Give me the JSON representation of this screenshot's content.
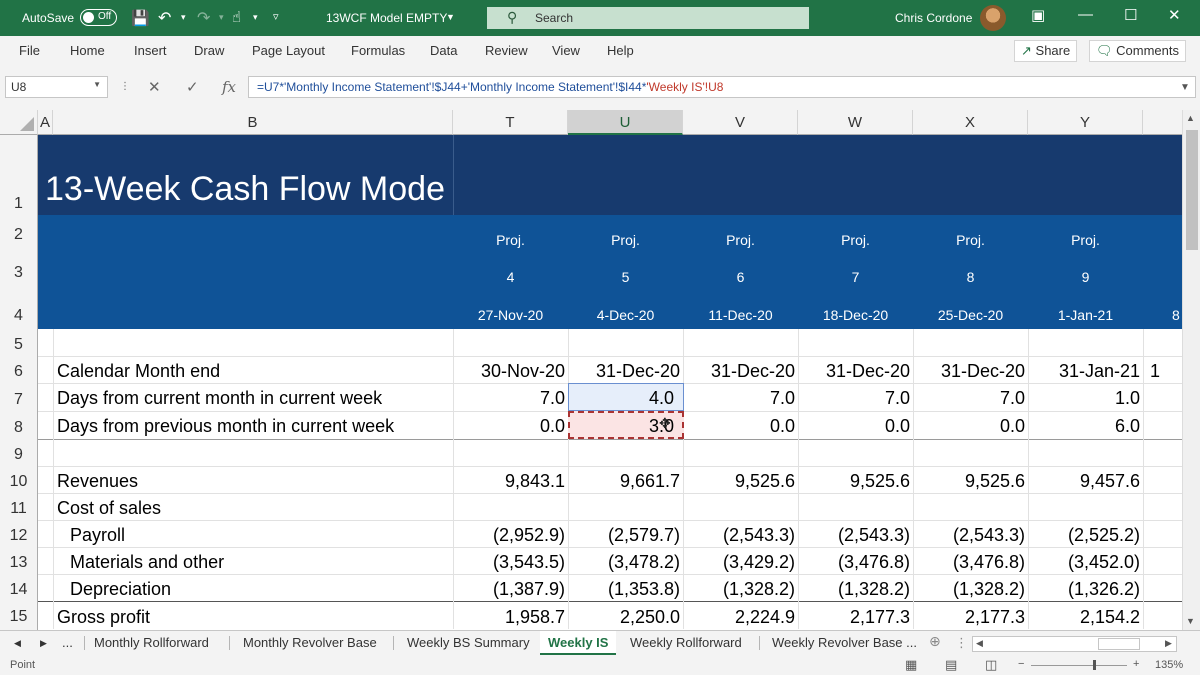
{
  "titlebar": {
    "autosave_label": "AutoSave",
    "autosave_state": "Off",
    "document_title": "13WCF Model EMPTY",
    "search_placeholder": "Search",
    "user_name": "Chris Cordone"
  },
  "ribbon": {
    "tabs": [
      "File",
      "Home",
      "Insert",
      "Draw",
      "Page Layout",
      "Formulas",
      "Data",
      "Review",
      "View",
      "Help"
    ],
    "share_label": "Share",
    "comments_label": "Comments"
  },
  "formula_bar": {
    "name_box": "U8",
    "fx": "fx",
    "formula_part1": "=U7*'Monthly Income Statement'!$J44+'Monthly Income Statement'!$I44*",
    "formula_part2": "'Weekly IS'!U8"
  },
  "grid": {
    "column_headers": [
      "A",
      "B",
      "T",
      "U",
      "V",
      "W",
      "X",
      "Y"
    ],
    "row_numbers": [
      "1",
      "2",
      "3",
      "4",
      "5",
      "6",
      "7",
      "8",
      "9",
      "10",
      "11",
      "12",
      "13",
      "14",
      "15"
    ],
    "title": "13-Week Cash Flow Mode",
    "proj_label": "Proj.",
    "week_numbers": [
      "4",
      "5",
      "6",
      "7",
      "8",
      "9"
    ],
    "week_dates": [
      "27-Nov-20",
      "4-Dec-20",
      "11-Dec-20",
      "18-Dec-20",
      "25-Dec-20",
      "1-Jan-21"
    ],
    "overflow_date_fragment": "8",
    "overflow_month_fragment": "1",
    "rows": [
      {
        "label": "Calendar Month end",
        "values": [
          "30-Nov-20",
          "31-Dec-20",
          "31-Dec-20",
          "31-Dec-20",
          "31-Dec-20",
          "31-Jan-21"
        ]
      },
      {
        "label": "Days from current month in current week",
        "values": [
          "7.0",
          "4.0",
          "7.0",
          "7.0",
          "7.0",
          "1.0"
        ]
      },
      {
        "label": "Days from previous month in current week",
        "values": [
          "0.0",
          "3.0",
          "0.0",
          "0.0",
          "0.0",
          "6.0"
        ]
      },
      {
        "label": "",
        "values": []
      },
      {
        "label": "Revenues",
        "values": [
          "9,843.1",
          "9,661.7",
          "9,525.6",
          "9,525.6",
          "9,525.6",
          "9,457.6"
        ]
      },
      {
        "label": "Cost of sales",
        "values": []
      },
      {
        "label": "Payroll",
        "values": [
          "(2,952.9)",
          "(2,579.7)",
          "(2,543.3)",
          "(2,543.3)",
          "(2,543.3)",
          "(2,525.2)"
        ]
      },
      {
        "label": "Materials and other",
        "values": [
          "(3,543.5)",
          "(3,478.2)",
          "(3,429.2)",
          "(3,476.8)",
          "(3,476.8)",
          "(3,452.0)"
        ]
      },
      {
        "label": "Depreciation",
        "values": [
          "(1,387.9)",
          "(1,353.8)",
          "(1,328.2)",
          "(1,328.2)",
          "(1,328.2)",
          "(1,326.2)"
        ]
      },
      {
        "label": "Gross profit",
        "values": [
          "1,958.7",
          "2,250.0",
          "2,224.9",
          "2,177.3",
          "2,177.3",
          "2,154.2"
        ]
      }
    ]
  },
  "sheet_tabs": {
    "ellipsis": "...",
    "tabs": [
      "Monthly Rollforward",
      "Monthly Revolver Base",
      "Weekly BS Summary",
      "Weekly IS",
      "Weekly Rollforward",
      "Weekly Revolver Base ..."
    ],
    "active": "Weekly IS"
  },
  "status_bar": {
    "mode": "Point",
    "zoom": "135%"
  },
  "colors": {
    "excel_green": "#217346",
    "header_dark_blue": "#173a6e",
    "header_mid_blue": "#0f5397"
  }
}
